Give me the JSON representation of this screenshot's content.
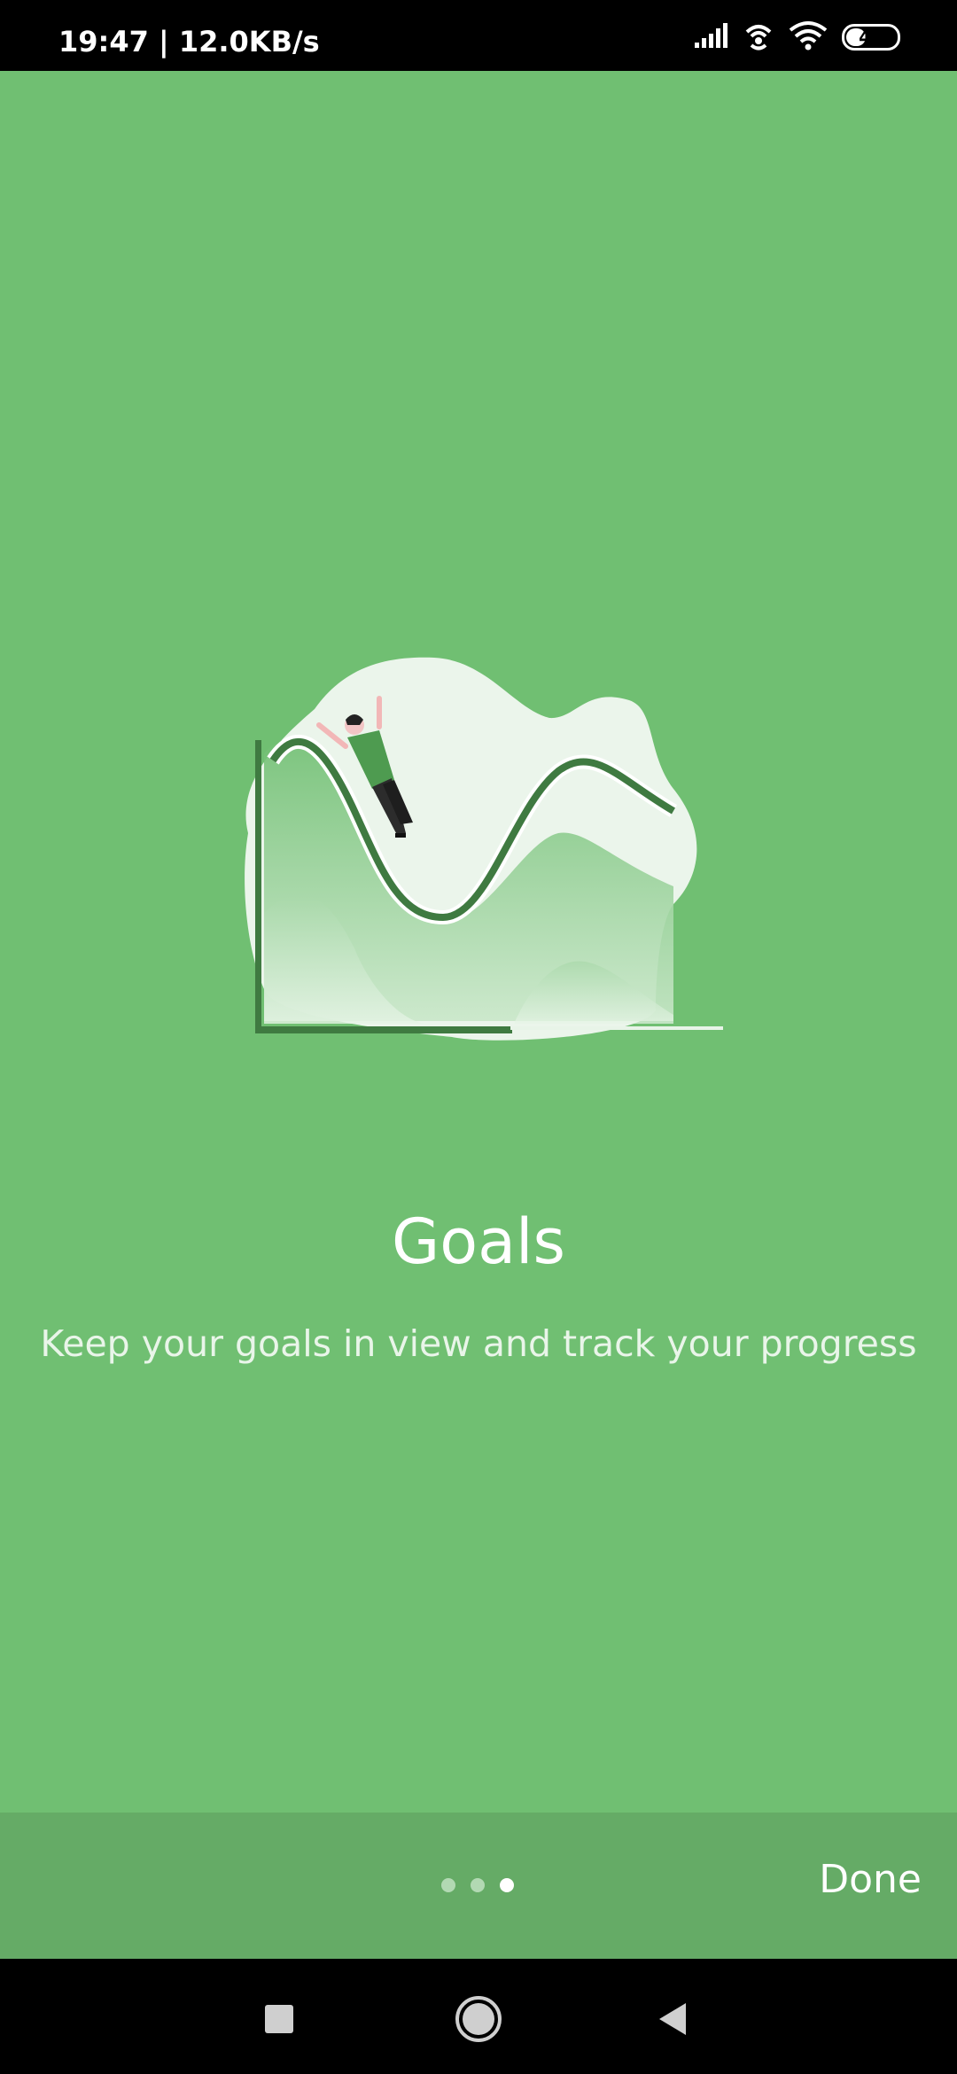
{
  "status_bar": {
    "time": "19:47 | 12.0KB/s",
    "icons": [
      "signal-icon",
      "hotspot-icon",
      "wifi-icon",
      "battery-icon"
    ],
    "battery_level": "44",
    "battery_fraction": 0.44
  },
  "onboarding": {
    "title": "Goals",
    "subtitle": "Keep your goals in view and track your progress",
    "illustration": "goals-chart-illustration"
  },
  "pager": {
    "pages": 3,
    "current": 3,
    "done_label": "Done"
  },
  "nav_bar": {
    "buttons": [
      "recents-icon",
      "home-icon",
      "back-icon"
    ]
  },
  "colors": {
    "background": "#70bf72",
    "bottom_bar": "#65ab66",
    "status_bar": "#000000",
    "text": "#ffffff"
  }
}
